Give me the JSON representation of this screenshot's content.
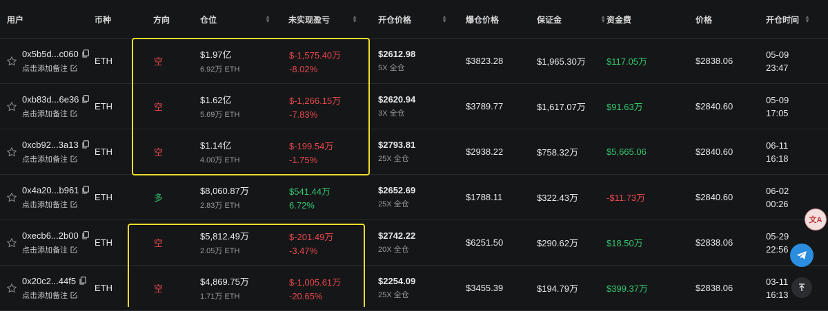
{
  "columns": {
    "user": "用户",
    "coin": "币种",
    "direction": "方向",
    "position": "仓位",
    "unrealized_pnl": "未实现盈亏",
    "entry_price": "开仓价格",
    "liq_price": "爆仓价格",
    "margin": "保证金",
    "funding_fee": "资金费",
    "price": "价格",
    "open_time": "开仓时间"
  },
  "rows": [
    {
      "address": "0x5b5d...c060",
      "note": "点击添加备注",
      "coin": "ETH",
      "direction": "空",
      "side": "short",
      "position_value": "$1.97亿",
      "position_size": "6.92万 ETH",
      "pnl": "$-1,575.40万",
      "pnl_pct": "-8.02%",
      "pnl_color": "red",
      "entry_price": "$2612.98",
      "leverage": "5X 全仓",
      "liq_price": "$3823.28",
      "margin": "$1,965.30万",
      "funding_fee": "$117.05万",
      "funding_color": "green",
      "price": "$2838.06",
      "open_date": "05-09",
      "open_clock": "23:47"
    },
    {
      "address": "0xb83d...6e36",
      "note": "点击添加备注",
      "coin": "ETH",
      "direction": "空",
      "side": "short",
      "position_value": "$1.62亿",
      "position_size": "5.69万 ETH",
      "pnl": "$-1,266.15万",
      "pnl_pct": "-7.83%",
      "pnl_color": "red",
      "entry_price": "$2620.94",
      "leverage": "3X 全仓",
      "liq_price": "$3789.77",
      "margin": "$1,617.07万",
      "funding_fee": "$91.63万",
      "funding_color": "green",
      "price": "$2840.60",
      "open_date": "05-09",
      "open_clock": "17:05"
    },
    {
      "address": "0xcb92...3a13",
      "note": "点击添加备注",
      "coin": "ETH",
      "direction": "空",
      "side": "short",
      "position_value": "$1.14亿",
      "position_size": "4.00万 ETH",
      "pnl": "$-199.54万",
      "pnl_pct": "-1.75%",
      "pnl_color": "red",
      "entry_price": "$2793.81",
      "leverage": "25X 全仓",
      "liq_price": "$2938.22",
      "margin": "$758.32万",
      "funding_fee": "$5,665.06",
      "funding_color": "green",
      "price": "$2840.60",
      "open_date": "06-11",
      "open_clock": "16:18"
    },
    {
      "address": "0x4a20...b961",
      "note": "点击添加备注",
      "coin": "ETH",
      "direction": "多",
      "side": "long",
      "position_value": "$8,060.87万",
      "position_size": "2.83万 ETH",
      "pnl": "$541.44万",
      "pnl_pct": "6.72%",
      "pnl_color": "green",
      "entry_price": "$2652.69",
      "leverage": "25X 全仓",
      "liq_price": "$1788.11",
      "margin": "$322.43万",
      "funding_fee": "-$11.73万",
      "funding_color": "red",
      "price": "$2840.60",
      "open_date": "06-02",
      "open_clock": "00:26"
    },
    {
      "address": "0xecb6...2b00",
      "note": "点击添加备注",
      "coin": "ETH",
      "direction": "空",
      "side": "short",
      "position_value": "$5,812.49万",
      "position_size": "2.05万 ETH",
      "pnl": "$-201.49万",
      "pnl_pct": "-3.47%",
      "pnl_color": "red",
      "entry_price": "$2742.22",
      "leverage": "20X 全仓",
      "liq_price": "$6251.50",
      "margin": "$290.62万",
      "funding_fee": "$18.50万",
      "funding_color": "green",
      "price": "$2838.06",
      "open_date": "05-29",
      "open_clock": "22:56"
    },
    {
      "address": "0x20c2...44f5",
      "note": "点击添加备注",
      "coin": "ETH",
      "direction": "空",
      "side": "short",
      "position_value": "$4,869.75万",
      "position_size": "1.71万 ETH",
      "pnl": "$-1,005.61万",
      "pnl_pct": "-20.65%",
      "pnl_color": "red",
      "entry_price": "$2254.09",
      "leverage": "25X 全仓",
      "liq_price": "$3455.39",
      "margin": "$194.79万",
      "funding_fee": "$399.37万",
      "funding_color": "green",
      "price": "$2838.06",
      "open_date": "03-11",
      "open_clock": "16:13"
    }
  ],
  "colors": {
    "background": "#151618",
    "short": "#e6484c",
    "long": "#2ebd6e",
    "highlight": "#f0dd2a",
    "telegram": "#2a8de0"
  },
  "floating": {
    "translate_label": "文A",
    "telegram_icon": "telegram-icon",
    "top_icon": "back-to-top-icon"
  }
}
